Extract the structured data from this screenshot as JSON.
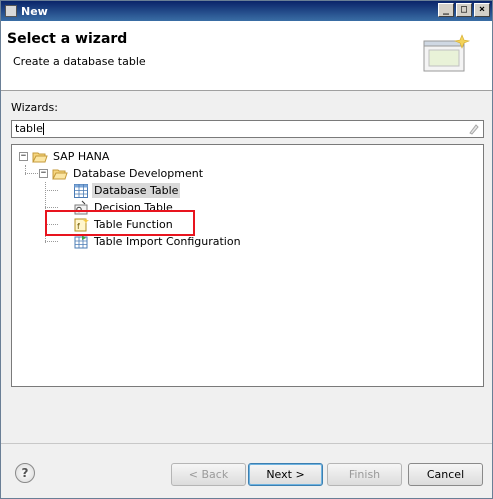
{
  "window": {
    "title": "New"
  },
  "banner": {
    "heading": "Select a wizard",
    "subheading": "Create a database table"
  },
  "wizards": {
    "label": "Wizards:",
    "filter_value": "table",
    "tree": [
      {
        "label": "SAP HANA",
        "icon": "folder-open-icon",
        "state": "expanded"
      },
      {
        "label": "Database Development",
        "icon": "folder-open-icon",
        "state": "expanded"
      },
      {
        "label": "Database Table",
        "icon": "table-grid-icon",
        "selected": true
      },
      {
        "label": "Decision Table",
        "icon": "decision-table-icon"
      },
      {
        "label": "Table Function",
        "icon": "table-function-icon",
        "highlighted": true
      },
      {
        "label": "Table Import Configuration",
        "icon": "table-import-icon"
      }
    ]
  },
  "buttons": {
    "back": "< Back",
    "next": "Next >",
    "finish": "Finish",
    "cancel": "Cancel",
    "help": "?"
  },
  "colors": {
    "annotation": "#e8141e",
    "titlebar": "#0a246a"
  }
}
